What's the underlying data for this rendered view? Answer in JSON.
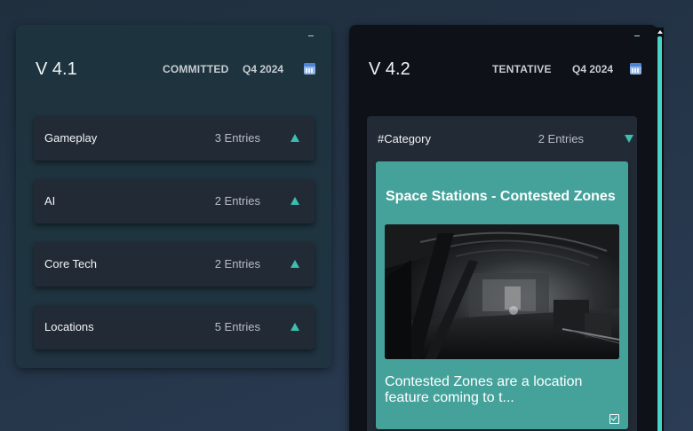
{
  "releases": [
    {
      "version": "V 4.1",
      "status": "COMMITTED",
      "quarter": "Q4 2024",
      "icon": "calendar-icon",
      "categories": [
        {
          "label": "Gameplay",
          "count": "3 Entries",
          "expanded": false
        },
        {
          "label": "AI",
          "count": "2 Entries",
          "expanded": false
        },
        {
          "label": "Core Tech",
          "count": "2 Entries",
          "expanded": false
        },
        {
          "label": "Locations",
          "count": "5 Entries",
          "expanded": false
        }
      ]
    },
    {
      "version": "V 4.2",
      "status": "TENTATIVE",
      "quarter": "Q4 2024",
      "icon": "calendar-icon",
      "categories": [
        {
          "label": "#Category",
          "count": "2 Entries",
          "expanded": true,
          "cards": [
            {
              "title": "Space Stations - Contested Zones",
              "description": "Contested Zones are a location feature coming to t...",
              "checked": true
            }
          ]
        }
      ]
    }
  ],
  "colors": {
    "accent": "#3bbfae",
    "card": "#44a29b",
    "committed_column": "#1d333e",
    "tentative_column": "#0e1117",
    "category_bg": "#222a35",
    "scroll_thumb": "#47d3c6"
  }
}
